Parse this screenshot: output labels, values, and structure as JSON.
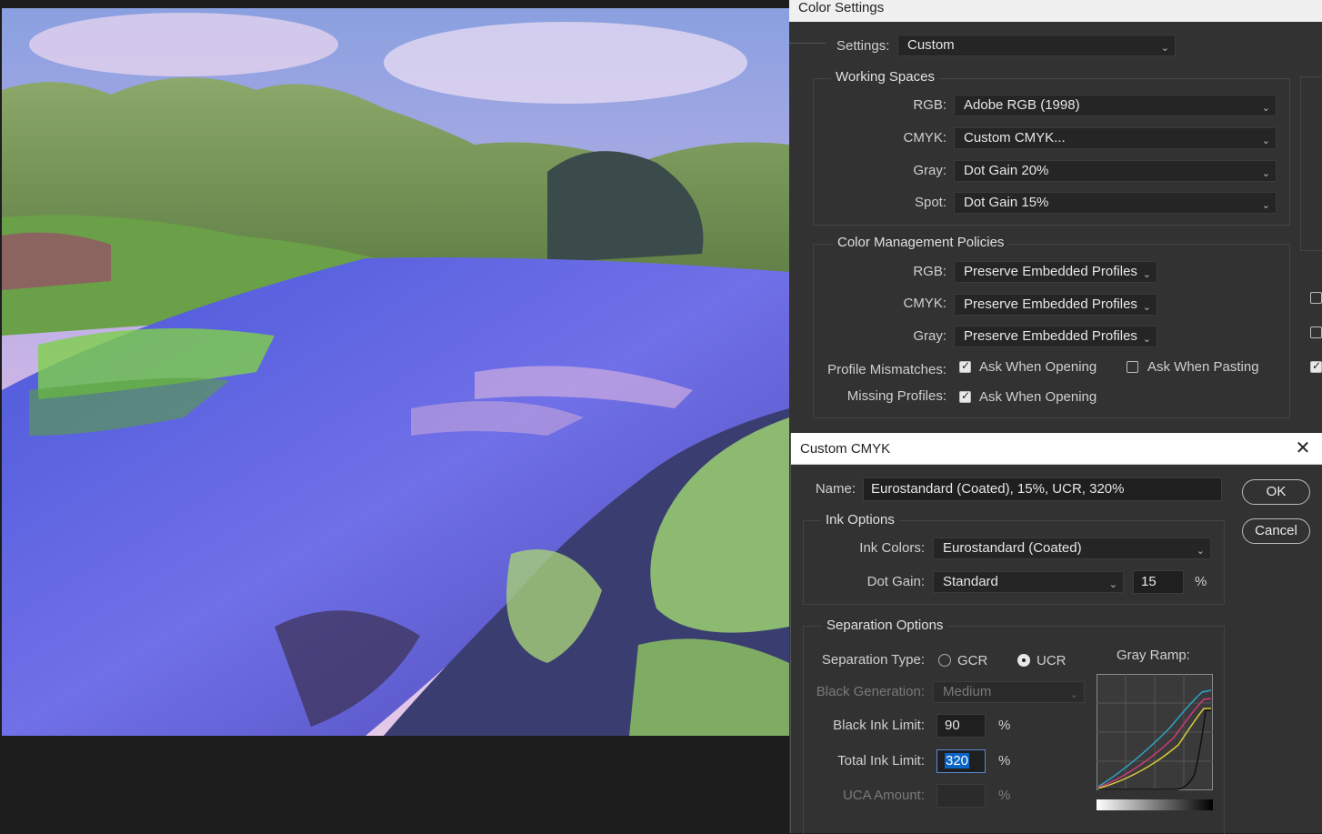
{
  "color_settings": {
    "title": "Color Settings",
    "settings_label": "Settings:",
    "settings_value": "Custom",
    "working_spaces": {
      "title": "Working Spaces",
      "rgb_label": "RGB:",
      "rgb_value": "Adobe RGB (1998)",
      "cmyk_label": "CMYK:",
      "cmyk_value": "Custom CMYK...",
      "gray_label": "Gray:",
      "gray_value": "Dot Gain 20%",
      "spot_label": "Spot:",
      "spot_value": "Dot Gain 15%"
    },
    "policies": {
      "title": "Color Management Policies",
      "rgb_label": "RGB:",
      "rgb_value": "Preserve Embedded Profiles",
      "cmyk_label": "CMYK:",
      "cmyk_value": "Preserve Embedded Profiles",
      "gray_label": "Gray:",
      "gray_value": "Preserve Embedded Profiles",
      "mismatch_label": "Profile Mismatches:",
      "mismatch_open_label": "Ask When Opening",
      "mismatch_open_checked": true,
      "mismatch_paste_label": "Ask When Pasting",
      "mismatch_paste_checked": false,
      "missing_label": "Missing Profiles:",
      "missing_open_label": "Ask When Opening",
      "missing_open_checked": true
    }
  },
  "custom_cmyk": {
    "title": "Custom CMYK",
    "close_icon": "close-icon",
    "name_label": "Name:",
    "name_value": "Eurostandard (Coated), 15%, UCR, 320%",
    "ok_label": "OK",
    "cancel_label": "Cancel",
    "ink_options": {
      "title": "Ink Options",
      "ink_colors_label": "Ink Colors:",
      "ink_colors_value": "Eurostandard (Coated)",
      "dot_gain_label": "Dot Gain:",
      "dot_gain_value": "Standard",
      "dot_gain_percent": "15",
      "percent": "%"
    },
    "separation": {
      "title": "Separation Options",
      "type_label": "Separation Type:",
      "gcr_label": "GCR",
      "ucr_label": "UCR",
      "selected": "UCR",
      "black_gen_label": "Black Generation:",
      "black_gen_value": "Medium",
      "black_ink_label": "Black Ink Limit:",
      "black_ink_value": "90",
      "total_ink_label": "Total Ink Limit:",
      "total_ink_value": "320",
      "uca_label": "UCA Amount:",
      "uca_value": "",
      "percent": "%",
      "gray_ramp_label": "Gray Ramp:"
    }
  },
  "colors": {
    "accent_selection": "#0a64c8",
    "ramp_cyan": "#2fa3c8",
    "ramp_magenta": "#d03a7a",
    "ramp_yellow": "#d8c838",
    "ramp_black": "#111111"
  }
}
